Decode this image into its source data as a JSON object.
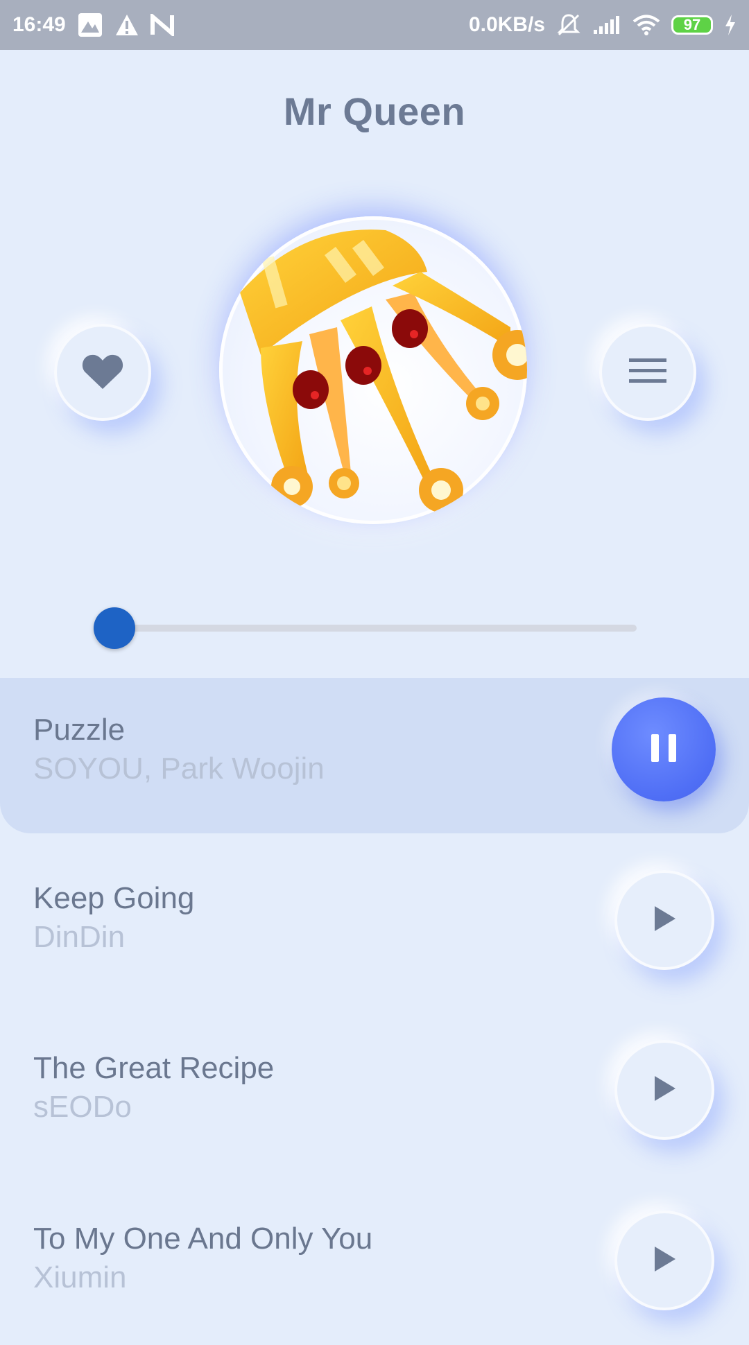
{
  "status_bar": {
    "time": "16:49",
    "network_speed": "0.0KB/s",
    "battery": "97",
    "icons": [
      "gallery-icon",
      "warning-icon",
      "n-icon",
      "mute-icon",
      "signal-icon",
      "wifi-icon",
      "battery-icon",
      "charging-icon"
    ]
  },
  "header": {
    "title": "Mr Queen"
  },
  "controls": {
    "favorite_icon": "heart-icon",
    "menu_icon": "menu-icon"
  },
  "album_art": {
    "subject": "crown"
  },
  "progress": {
    "fraction": 0.0
  },
  "tracks": [
    {
      "title": "Puzzle",
      "artist": "SOYOU, Park Woojin",
      "state": "playing"
    },
    {
      "title": "Keep Going",
      "artist": "DinDin",
      "state": "paused"
    },
    {
      "title": "The Great Recipe",
      "artist": "sEODo",
      "state": "paused"
    },
    {
      "title": "To My One And Only You",
      "artist": "Xiumin",
      "state": "paused"
    }
  ],
  "colors": {
    "background": "#e4edfb",
    "accent": "#4f6ef5",
    "slider_thumb": "#1e63c5",
    "active_row": "#d0ddf5",
    "text_primary": "#6a778f",
    "text_secondary": "#b7c2d6"
  }
}
